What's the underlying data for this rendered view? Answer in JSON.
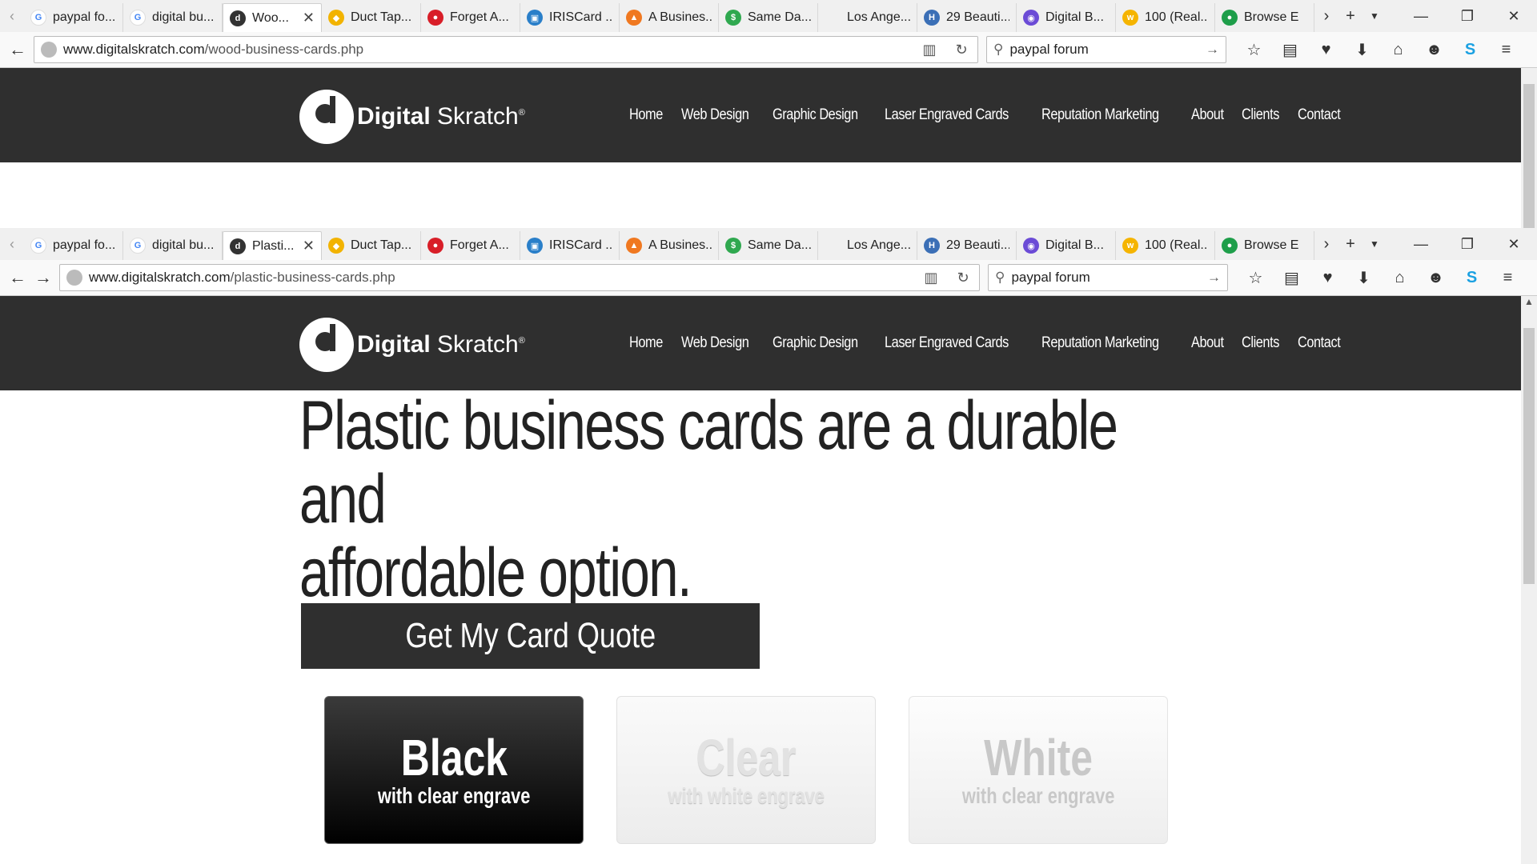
{
  "top_window": {
    "tabs": [
      {
        "title": "paypal fo...",
        "favicon": "google-icon",
        "color": "#4285f4",
        "glyph": "G"
      },
      {
        "title": "digital bu...",
        "favicon": "google-icon",
        "color": "#4285f4",
        "glyph": "G"
      },
      {
        "title": "Woo...",
        "favicon": "digitalskratch-icon",
        "color": "#333333",
        "glyph": "d",
        "active": true
      },
      {
        "title": "Duct Tap...",
        "favicon": "ducttape-icon",
        "color": "#f2b300",
        "glyph": "◆"
      },
      {
        "title": "Forget A...",
        "favicon": "forget-icon",
        "color": "#d81e28",
        "glyph": "●"
      },
      {
        "title": "IRISCard ...",
        "favicon": "iriscard-icon",
        "color": "#2a7fc9",
        "glyph": "▣"
      },
      {
        "title": "A Busines...",
        "favicon": "business-icon",
        "color": "#f07820",
        "glyph": "▲"
      },
      {
        "title": "Same Da...",
        "favicon": "sameday-icon",
        "color": "#2fa84f",
        "glyph": "$"
      },
      {
        "title": "Los Ange...",
        "favicon": "blank-icon",
        "color": "#f0f0f0",
        "glyph": ""
      },
      {
        "title": "29 Beauti...",
        "favicon": "hongkiat-icon",
        "color": "#3b6fb6",
        "glyph": "H"
      },
      {
        "title": "Digital B...",
        "favicon": "digitalb-icon",
        "color": "#6b4bd6",
        "glyph": "◉"
      },
      {
        "title": "100 (Real...",
        "favicon": "realtor-icon",
        "color": "#f5b400",
        "glyph": "w"
      },
      {
        "title": "Browse E",
        "favicon": "drop-icon",
        "color": "#1e9e4a",
        "glyph": "●"
      }
    ],
    "url_host": "www.digitalskratch.com",
    "url_path": "/wood-business-cards.php",
    "search_value": "paypal forum"
  },
  "bottom_window": {
    "tabs": [
      {
        "title": "paypal fo...",
        "favicon": "google-icon",
        "color": "#4285f4",
        "glyph": "G"
      },
      {
        "title": "digital bu...",
        "favicon": "google-icon",
        "color": "#4285f4",
        "glyph": "G"
      },
      {
        "title": "Plasti...",
        "favicon": "digitalskratch-icon",
        "color": "#333333",
        "glyph": "d",
        "active": true
      },
      {
        "title": "Duct Tap...",
        "favicon": "ducttape-icon",
        "color": "#f2b300",
        "glyph": "◆"
      },
      {
        "title": "Forget A...",
        "favicon": "forget-icon",
        "color": "#d81e28",
        "glyph": "●"
      },
      {
        "title": "IRISCard ...",
        "favicon": "iriscard-icon",
        "color": "#2a7fc9",
        "glyph": "▣"
      },
      {
        "title": "A Busines...",
        "favicon": "business-icon",
        "color": "#f07820",
        "glyph": "▲"
      },
      {
        "title": "Same Da...",
        "favicon": "sameday-icon",
        "color": "#2fa84f",
        "glyph": "$"
      },
      {
        "title": "Los Ange...",
        "favicon": "blank-icon",
        "color": "#f0f0f0",
        "glyph": ""
      },
      {
        "title": "29 Beauti...",
        "favicon": "hongkiat-icon",
        "color": "#3b6fb6",
        "glyph": "H"
      },
      {
        "title": "Digital B...",
        "favicon": "digitalb-icon",
        "color": "#6b4bd6",
        "glyph": "◉"
      },
      {
        "title": "100 (Real...",
        "favicon": "realtor-icon",
        "color": "#f5b400",
        "glyph": "w"
      },
      {
        "title": "Browse E",
        "favicon": "drop-icon",
        "color": "#1e9e4a",
        "glyph": "●"
      }
    ],
    "url_host": "www.digitalskratch.com",
    "url_path": "/plastic-business-cards.php",
    "search_value": "paypal forum"
  },
  "site": {
    "logo_bold": "Digital",
    "logo_light": "Skratch",
    "logo_mark": "®",
    "nav": [
      "Home",
      "Web Design",
      "Graphic Design",
      "Laser Engraved Cards",
      "Reputation Marketing",
      "About",
      "Clients",
      "Contact"
    ],
    "headline_line1": "Plastic business cards are a durable and",
    "headline_line2": "affordable option.",
    "cta_label": "Get My Card Quote",
    "cards": [
      {
        "name": "Black",
        "sub": "with clear engrave",
        "style": "black"
      },
      {
        "name": "Clear",
        "sub": "with white engrave",
        "style": "clear"
      },
      {
        "name": "White",
        "sub": "with clear engrave",
        "style": "white"
      }
    ]
  },
  "colors": {
    "header_bg": "#2f2f2f",
    "button_bg": "#2f2f2f",
    "skype_blue": "#1ba1e2"
  }
}
